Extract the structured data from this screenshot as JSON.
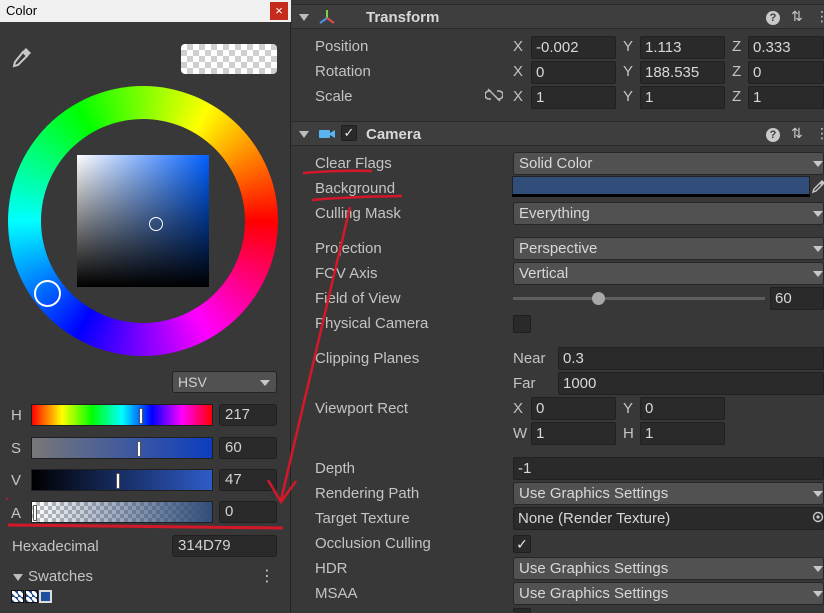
{
  "color_window": {
    "title": "Color",
    "close_icon": "×",
    "mode": "HSV",
    "sliders": [
      {
        "label": "H",
        "value": "217",
        "fraction": 0.6
      },
      {
        "label": "S",
        "value": "60",
        "fraction": 0.6
      },
      {
        "label": "V",
        "value": "47",
        "fraction": 0.47
      },
      {
        "label": "A",
        "value": "0",
        "fraction": 0.0
      }
    ],
    "hex_label": "Hexadecimal",
    "hex_value": "314D79",
    "swatches_label": "Swatches",
    "menu_icon": "⋮",
    "colors": {
      "current": "#314D79"
    }
  },
  "transform": {
    "title": "Transform",
    "icons": [
      "help-icon",
      "presets-icon",
      "more-icon"
    ],
    "rows": [
      {
        "label": "Position",
        "x": "-0.002",
        "y": "1.113",
        "z": "0.333"
      },
      {
        "label": "Rotation",
        "x": "0",
        "y": "188.535",
        "z": "0"
      },
      {
        "label": "Scale",
        "x": "1",
        "y": "1",
        "z": "1"
      }
    ]
  },
  "axis": {
    "x": "X",
    "y": "Y",
    "z": "Z",
    "w": "W",
    "h": "H"
  },
  "header_icons": {
    "help": "?",
    "presets": "⇅",
    "more": "⋮"
  },
  "camera": {
    "title": "Camera",
    "enabled": true,
    "check": "✓",
    "clear_flags": {
      "label": "Clear Flags",
      "value": "Solid Color"
    },
    "background": {
      "label": "Background",
      "color": "#314D79"
    },
    "culling_mask": {
      "label": "Culling Mask",
      "value": "Everything"
    },
    "projection": {
      "label": "Projection",
      "value": "Perspective"
    },
    "fov_axis": {
      "label": "FOV Axis",
      "value": "Vertical"
    },
    "field_of_view": {
      "label": "Field of View",
      "value": "60",
      "fraction": 0.35
    },
    "physical_camera": {
      "label": "Physical Camera",
      "checked": false
    },
    "clipping_planes": {
      "label": "Clipping Planes",
      "near_label": "Near",
      "near": "0.3",
      "far_label": "Far",
      "far": "1000"
    },
    "viewport_rect": {
      "label": "Viewport Rect",
      "x": "0",
      "y": "0",
      "w": "1",
      "h": "1"
    },
    "depth": {
      "label": "Depth",
      "value": "-1"
    },
    "rendering_path": {
      "label": "Rendering Path",
      "value": "Use Graphics Settings"
    },
    "target_texture": {
      "label": "Target Texture",
      "value": "None (Render Texture)"
    },
    "occlusion_culling": {
      "label": "Occlusion Culling",
      "checked": true
    },
    "hdr": {
      "label": "HDR",
      "value": "Use Graphics Settings"
    },
    "msaa": {
      "label": "MSAA",
      "value": "Use Graphics Settings"
    }
  },
  "annotation_color": "#d4182a"
}
